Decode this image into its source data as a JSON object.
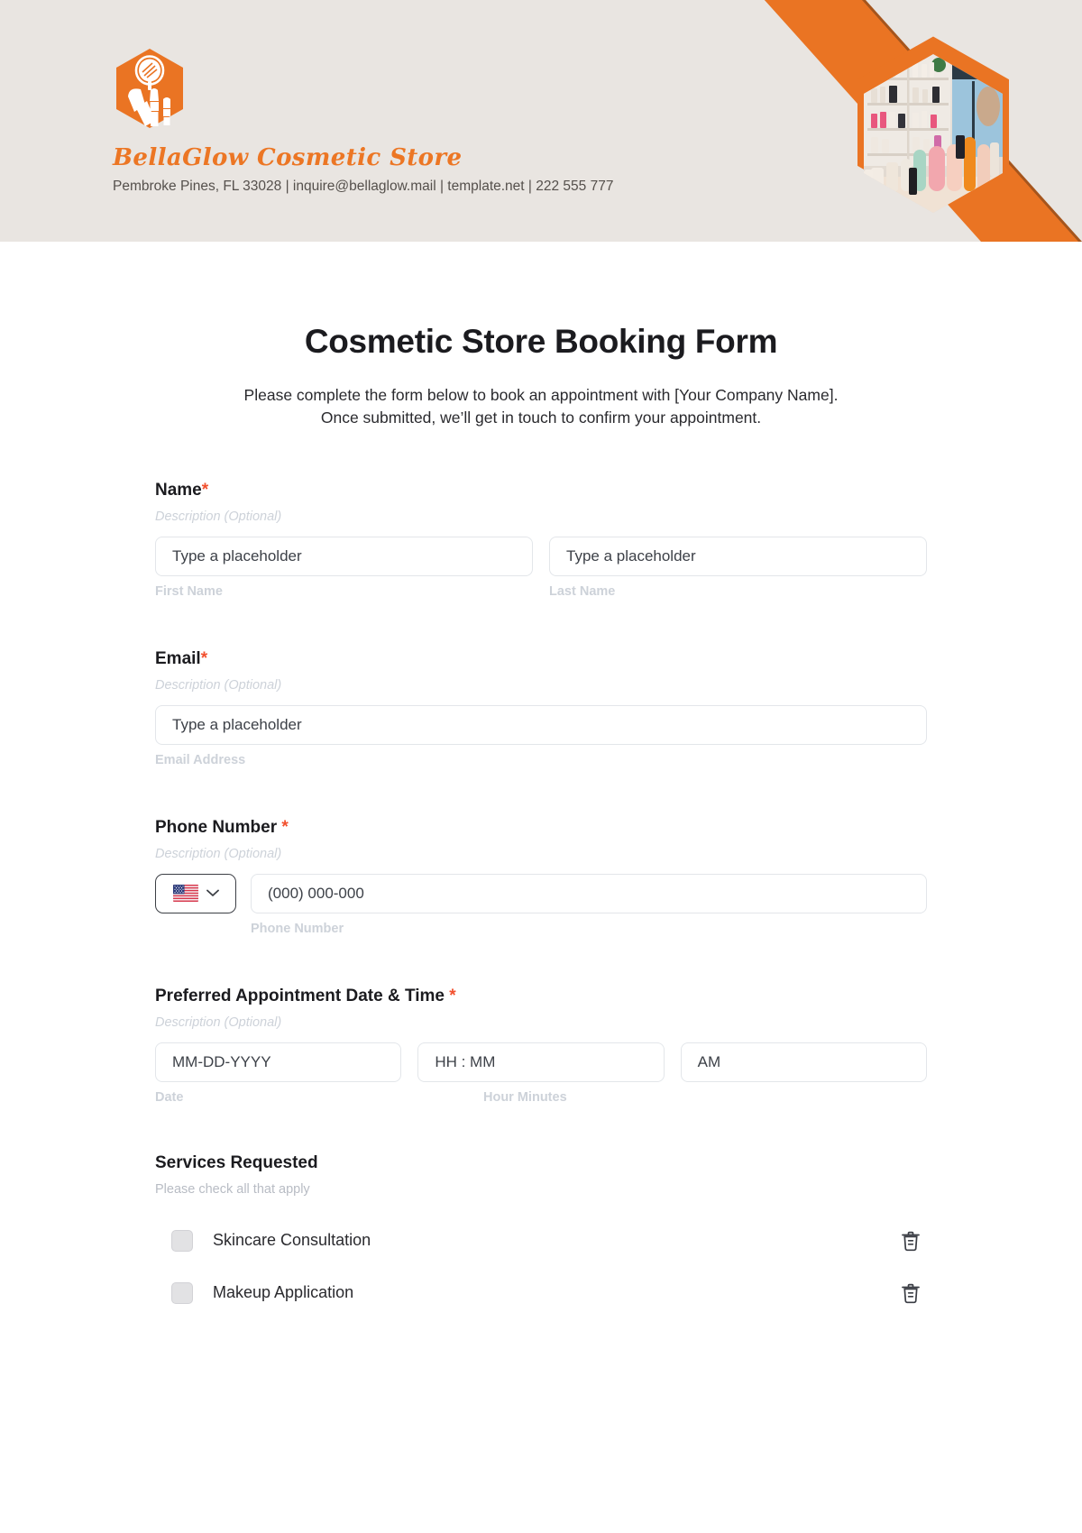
{
  "header": {
    "brand_name": "BellaGlow Cosmetic Store",
    "contact_line": "Pembroke Pines, FL 33028 | inquire@bellaglow.mail | template.net | 222 555 777",
    "logo_icon": "cosmetic-brushes-hexagon-icon",
    "photo_icon": "cosmetic-store-shelves-photo",
    "background_color": "#e9e5e1",
    "accent_color": "#ec7624",
    "accent_dark_color": "#a5551d"
  },
  "form": {
    "title": "Cosmetic Store Booking Form",
    "subtitle_line1": "Please complete the form below to book an appointment with [Your Company Name].",
    "subtitle_line2": "Once submitted, we’ll get in touch to confirm your appointment.",
    "required_marker": "*",
    "fields": {
      "name": {
        "label": "Name",
        "required": true,
        "description": "Description (Optional)",
        "first_placeholder": "Type a placeholder",
        "last_placeholder": "Type a placeholder",
        "first_sublabel": "First Name",
        "last_sublabel": "Last Name"
      },
      "email": {
        "label": "Email",
        "required": true,
        "description": "Description (Optional)",
        "placeholder": "Type a placeholder",
        "sublabel": "Email Address"
      },
      "phone": {
        "label": "Phone Number",
        "required": true,
        "description": "Description (Optional)",
        "country": "US",
        "country_flag_icon": "us-flag-icon",
        "dropdown_icon": "chevron-down-icon",
        "placeholder": "(000) 000-000",
        "sublabel": "Phone Number"
      },
      "appointment": {
        "label": "Preferred Appointment Date & Time",
        "required": true,
        "description": "Description (Optional)",
        "date_placeholder": "MM-DD-YYYY",
        "time_placeholder": "HH : MM",
        "ampm_value": "AM",
        "date_sublabel": "Date",
        "time_sublabel": "Hour Minutes"
      },
      "services": {
        "label": "Services Requested",
        "required": false,
        "description": "Please check all that apply",
        "delete_icon": "trash-icon",
        "options": [
          {
            "label": "Skincare Consultation",
            "checked": false
          },
          {
            "label": "Makeup Application",
            "checked": false
          }
        ]
      }
    }
  }
}
